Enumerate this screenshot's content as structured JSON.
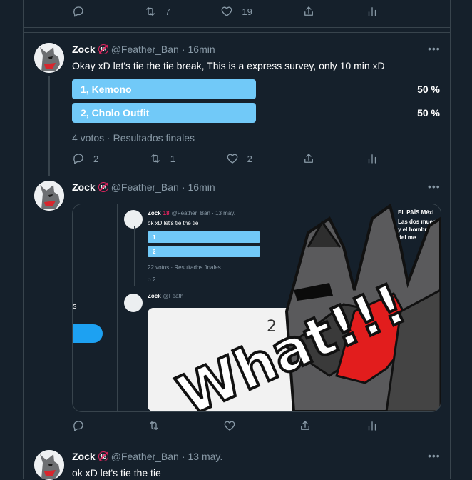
{
  "top_actions": {
    "reply": "",
    "retweet": "7",
    "like": "19",
    "share": "",
    "stats": ""
  },
  "tweet1": {
    "name": "Zock",
    "badge": "18",
    "handle": "@Feather_Ban",
    "sep": "·",
    "time": "16min",
    "more": "•••",
    "text": "Okay xD let's tie the tie break, This is a express survey, only 10 min xD",
    "poll": {
      "options": [
        {
          "label": "1, Kemono",
          "percent": "50 %",
          "fraction": 0.5
        },
        {
          "label": "2, Cholo Outfit",
          "percent": "50 %",
          "fraction": 0.5
        }
      ],
      "meta": "4 votos · Resultados finales"
    },
    "actions": {
      "reply": "2",
      "retweet": "1",
      "like": "2"
    }
  },
  "tweet2": {
    "name": "Zock",
    "badge": "18",
    "handle": "@Feather_Ban",
    "sep": "·",
    "time": "16min",
    "more": "•••",
    "media": {
      "inner_name": "Zock",
      "inner_badge": "18",
      "inner_handle": "@Feather_Ban · 13 may.",
      "inner_text": "ok xD let's tie the tie",
      "inner_opt1": "1",
      "inner_opt2": "2",
      "inner_meta": "22 votos · Resultados finales",
      "inner_reply": "2",
      "inner_name2": "Zock",
      "inner_handle2": "@Feath",
      "side_letter": "s",
      "news_title": "EL PAÍS Méxi",
      "news_line1": "Las dos muert",
      "news_line2": "y el hombre",
      "news_line3": "del me",
      "sketch_text": "What!!!",
      "sketch_num": "2"
    },
    "actions": {
      "reply": "",
      "retweet": "",
      "like": ""
    }
  },
  "tweet3": {
    "name": "Zock",
    "badge": "18",
    "handle": "@Feather_Ban",
    "sep": "·",
    "time": "13 may.",
    "more": "•••",
    "text": "ok xD let's tie the tie"
  }
}
